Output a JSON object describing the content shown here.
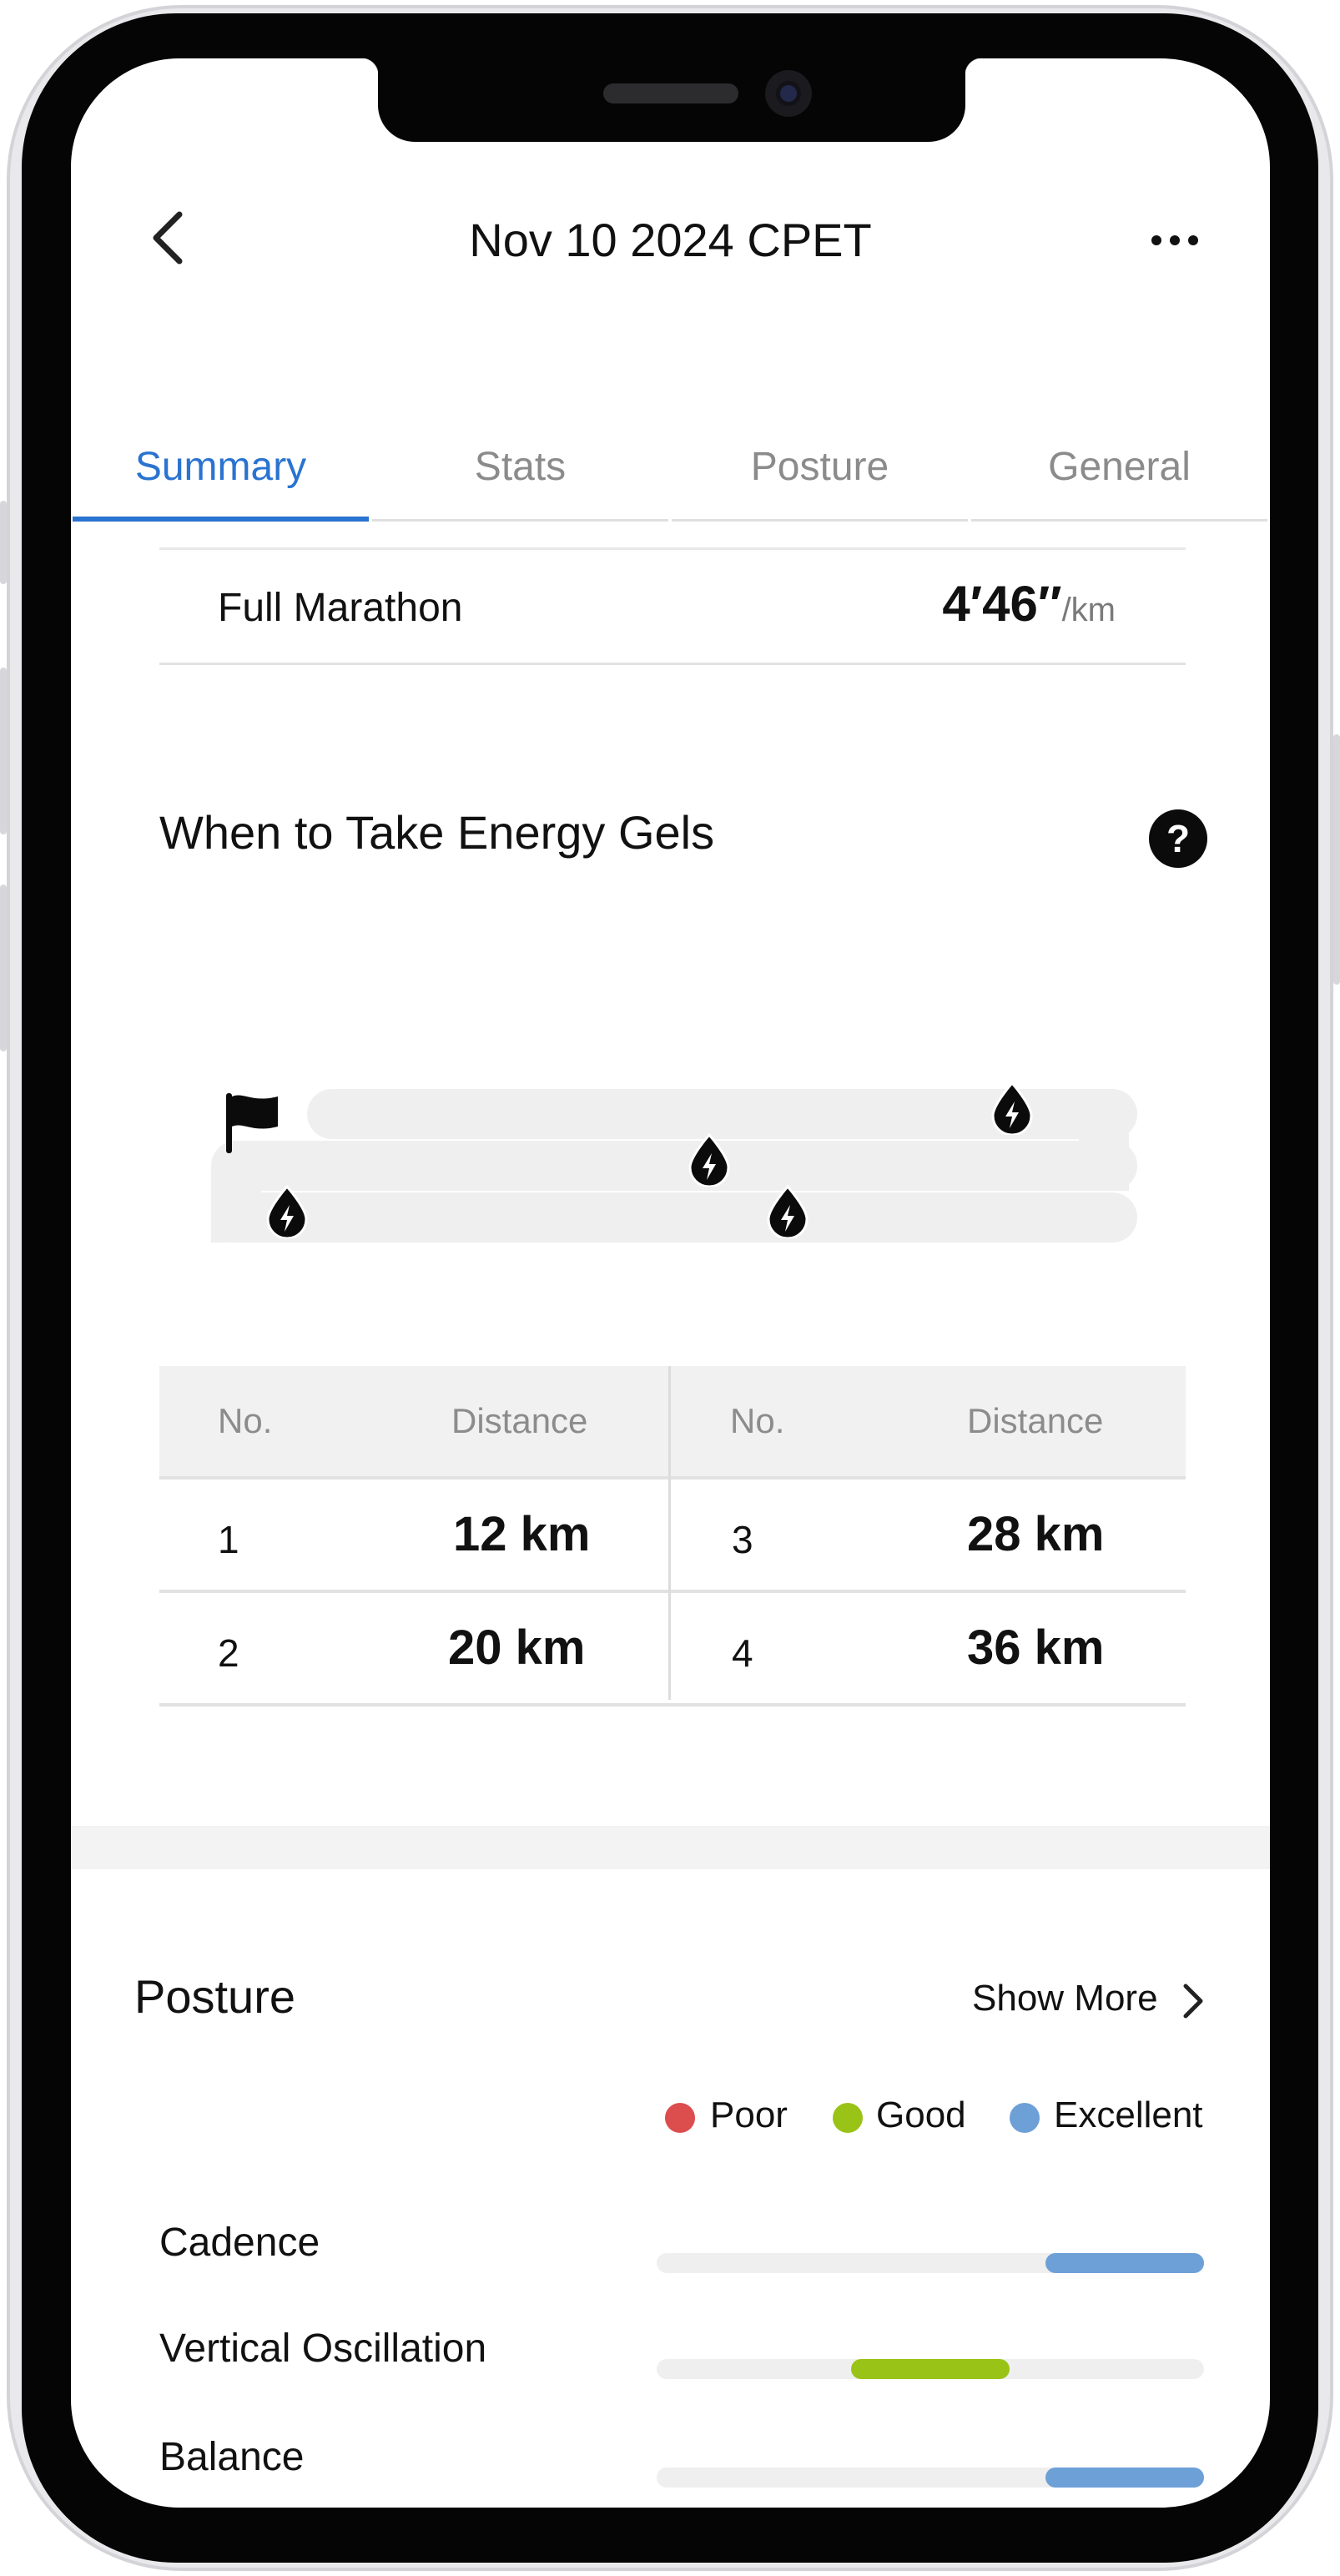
{
  "header": {
    "title": "Nov 10 2024 CPET"
  },
  "tabs": [
    {
      "label": "Summary",
      "active": true
    },
    {
      "label": "Stats",
      "active": false
    },
    {
      "label": "Posture",
      "active": false
    },
    {
      "label": "General",
      "active": false
    }
  ],
  "race": {
    "name": "Full Marathon",
    "pace": "4′46″",
    "pace_unit": "/km"
  },
  "gels": {
    "title": "When to Take Energy Gels",
    "help_icon": "?",
    "table": {
      "headers": {
        "no": "No.",
        "distance": "Distance"
      },
      "rows": [
        {
          "no": "1",
          "distance": "12 km"
        },
        {
          "no": "2",
          "distance": "20 km"
        },
        {
          "no": "3",
          "distance": "28 km"
        },
        {
          "no": "4",
          "distance": "36 km"
        }
      ]
    }
  },
  "posture": {
    "title": "Posture",
    "show_more": "Show More",
    "legend": [
      {
        "label": "Poor",
        "color": "#dc4d4d"
      },
      {
        "label": "Good",
        "color": "#9ac317"
      },
      {
        "label": "Excellent",
        "color": "#6ea0d8"
      }
    ],
    "metrics": [
      {
        "label": "Cadence",
        "rating": "Excellent",
        "level_start": 0.71,
        "level_end": 1.0,
        "color": "#6ea0d8"
      },
      {
        "label": "Vertical Oscillation",
        "rating": "Good",
        "level_start": 0.355,
        "level_end": 0.645,
        "color": "#9ac317"
      },
      {
        "label": "Balance",
        "rating": "Excellent",
        "level_start": 0.71,
        "level_end": 1.0,
        "color": "#6ea0d8"
      }
    ]
  }
}
